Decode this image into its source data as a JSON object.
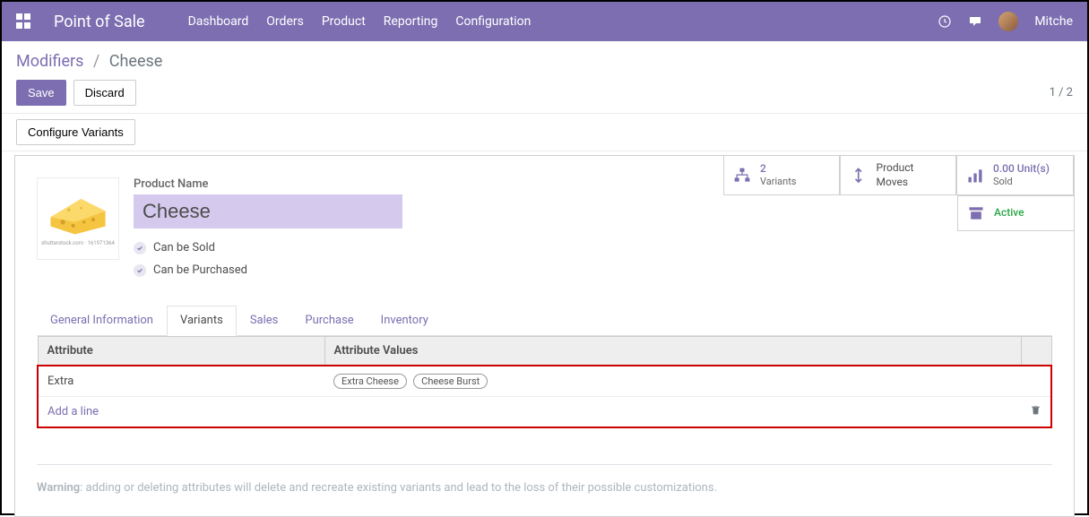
{
  "navbar": {
    "brand": "Point of Sale",
    "links": [
      "Dashboard",
      "Orders",
      "Product",
      "Reporting",
      "Configuration"
    ],
    "username": "Mitche"
  },
  "breadcrumb": {
    "parent": "Modifiers",
    "current": "Cheese"
  },
  "buttons": {
    "save": "Save",
    "discard": "Discard",
    "configure_variants": "Configure Variants"
  },
  "pager": "1 / 2",
  "product": {
    "name_label": "Product Name",
    "name": "Cheese",
    "can_be_sold": "Can be Sold",
    "can_be_purchased": "Can be Purchased",
    "img_caption": "shutterstock.com · 161971364"
  },
  "stats": {
    "variants_count": "2",
    "variants_label": "Variants",
    "product_moves": "Product Moves",
    "sold_value": "0.00 Unit(s)",
    "sold_label": "Sold",
    "active": "Active"
  },
  "tabs": [
    "General Information",
    "Variants",
    "Sales",
    "Purchase",
    "Inventory"
  ],
  "table": {
    "headers": {
      "attribute": "Attribute",
      "values": "Attribute Values"
    },
    "row1": {
      "attribute": "Extra",
      "tags": [
        "Extra Cheese",
        "Cheese Burst"
      ]
    },
    "add_line": "Add a line"
  },
  "warning": {
    "label": "Warning",
    "text": ": adding or deleting attributes will delete and recreate existing variants and lead to the loss of their possible customizations."
  }
}
